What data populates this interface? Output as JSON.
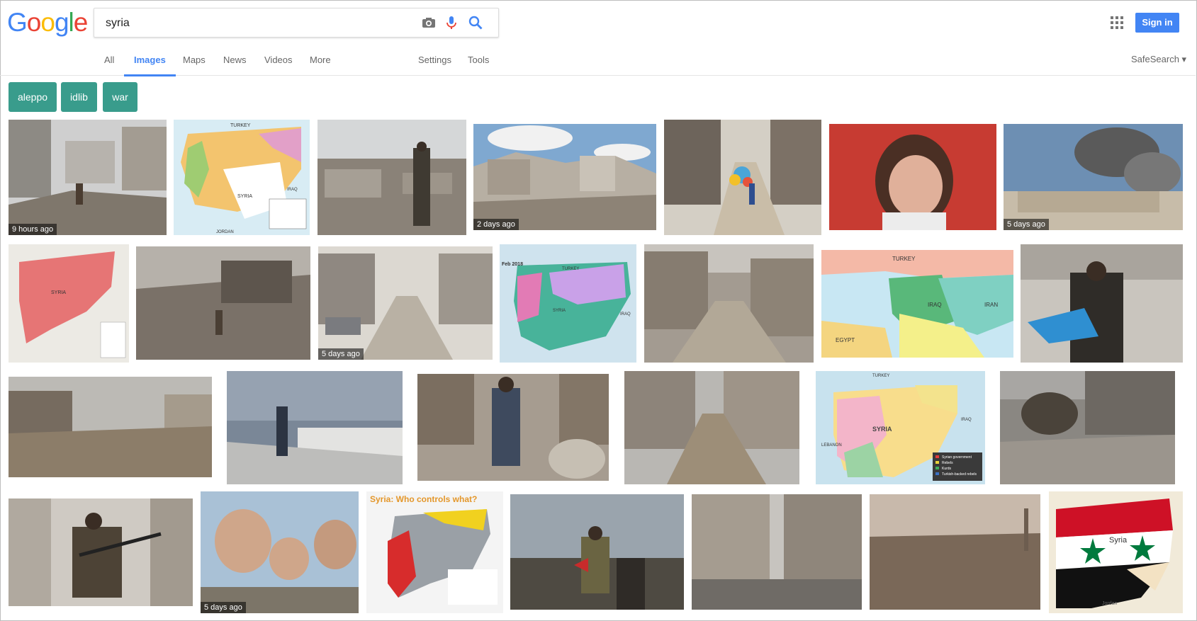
{
  "brand": "Google",
  "search": {
    "query": "syria"
  },
  "account": {
    "signin_label": "Sign in"
  },
  "tabs": [
    "All",
    "Images",
    "Maps",
    "News",
    "Videos",
    "More",
    "Settings",
    "Tools"
  ],
  "active_tab": "Images",
  "safesearch_label": "SafeSearch ▾",
  "chips": [
    "aleppo",
    "idlib",
    "war"
  ],
  "colors": {
    "accent": "#4285f4",
    "chip": "#399c8c",
    "syria_flag_red": "#ce1126",
    "syria_flag_green": "#007a3d"
  },
  "image_timestamps": {
    "r1c1": "9 hours ago",
    "r1c4": "2 days ago",
    "r1c7": "5 days ago",
    "r2c3": "5 days ago",
    "r4c2": "5 days ago"
  },
  "map_labels": {
    "r1_turkey": "TURKEY",
    "r1_syria": "SYRIA",
    "r1_iraq": "IRAQ",
    "r1_jordan": "JORDAN",
    "r2_syria": "SYRIA",
    "r2_date": "Feb 2018",
    "r2_turkey": "TURKEY",
    "r2_syria_b": "SYRIA",
    "r2_iraq": "IRAQ",
    "r2_mideast_turkey": "TURKEY",
    "r2_mideast_iraq": "IRAQ",
    "r2_mideast_iran": "IRAN",
    "r2_mideast_egypt": "EGYPT",
    "r3_turkey": "TURKEY",
    "r3_syria": "SYRIA",
    "r3_iraq": "IRAQ",
    "r3_lebanon": "LEBANON",
    "r3_legend": [
      "Syrian government",
      "Rebels",
      "Kurds",
      "Turkish-backed rebels"
    ],
    "r4_headline": "Syria: Who controls what?",
    "r4_flag_syria": "Syria",
    "r4_flag_jordan": "Jordan"
  }
}
